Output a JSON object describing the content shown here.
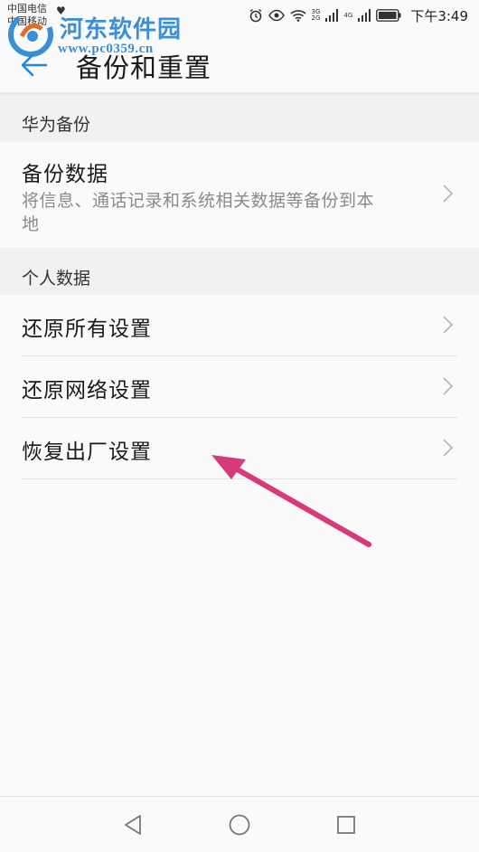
{
  "status_bar": {
    "carrier": "中国电信",
    "carrier2": "中国移动",
    "time": "下午3:49",
    "net_top": "3G",
    "net_bottom": "2G",
    "net2": "4G"
  },
  "watermark": {
    "title": "河东软件园",
    "url": "www.pc0359.cn"
  },
  "header": {
    "title": "备份和重置"
  },
  "sections": [
    {
      "title": "华为备份",
      "items": [
        {
          "title": "备份数据",
          "subtitle_line1": "将信息、通话记录和系统相关数据等备份到本",
          "subtitle_line2": "地"
        }
      ]
    },
    {
      "title": "个人数据",
      "items": [
        {
          "title": "还原所有设置"
        },
        {
          "title": "还原网络设置"
        },
        {
          "title": "恢复出厂设置"
        }
      ]
    }
  ],
  "colors": {
    "accent": "#1e88e5",
    "annotation": "#d63a7a",
    "watermark": "#3a8fd6"
  },
  "icons": {
    "back": "arrow-left-icon",
    "chevron": "chevron-right-icon",
    "nav_back": "triangle-back-icon",
    "nav_home": "circle-home-icon",
    "nav_recent": "square-recent-icon"
  }
}
